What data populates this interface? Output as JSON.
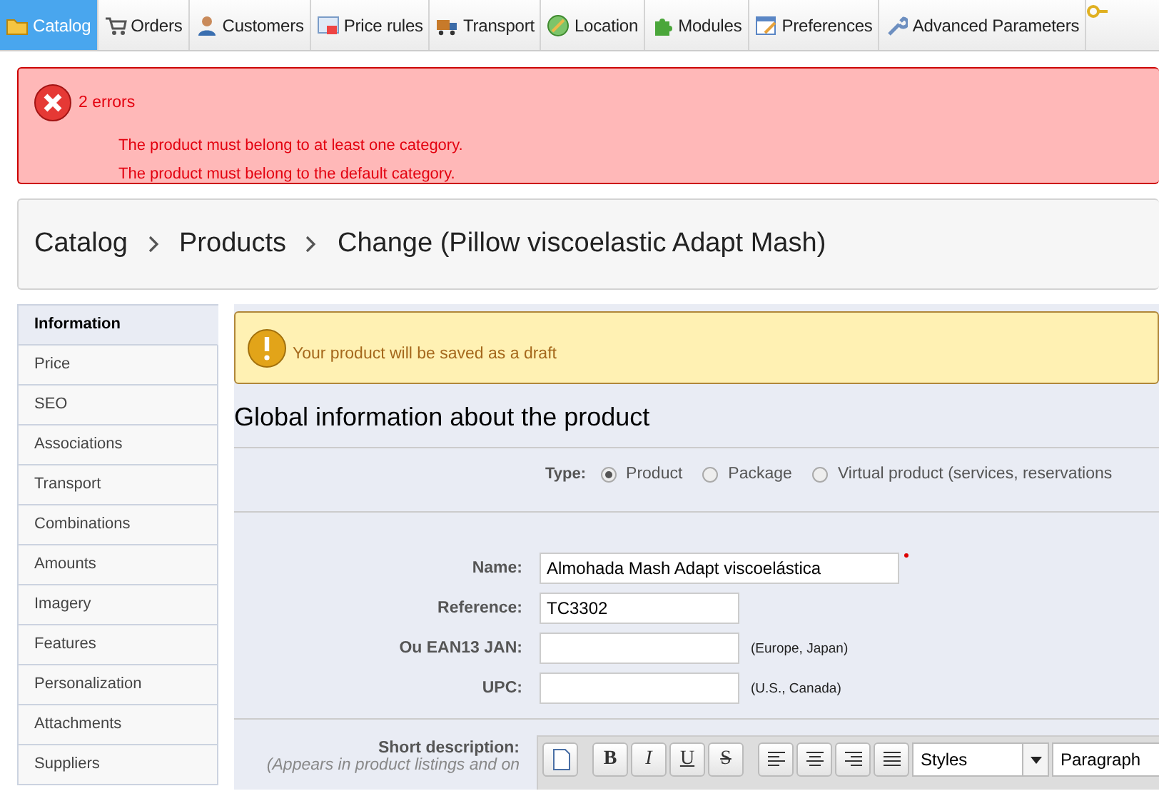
{
  "nav": [
    {
      "label": "Catalog",
      "selected": true
    },
    {
      "label": "Orders",
      "selected": false
    },
    {
      "label": "Customers",
      "selected": false
    },
    {
      "label": "Price rules",
      "selected": false
    },
    {
      "label": "Transport",
      "selected": false
    },
    {
      "label": "Location",
      "selected": false
    },
    {
      "label": "Modules",
      "selected": false
    },
    {
      "label": "Preferences",
      "selected": false
    },
    {
      "label": "Advanced Parameters",
      "selected": false
    }
  ],
  "errors": {
    "title": "2 errors",
    "messages": [
      "The product must belong to at least one category.",
      "The product must belong to the default category."
    ]
  },
  "breadcrumb": [
    "Catalog",
    "Products",
    "Change (Pillow viscoelastic Adapt Mash)"
  ],
  "sidebar": [
    {
      "label": "Information",
      "selected": true
    },
    {
      "label": "Price",
      "selected": false
    },
    {
      "label": "SEO",
      "selected": false
    },
    {
      "label": "Associations",
      "selected": false
    },
    {
      "label": "Transport",
      "selected": false
    },
    {
      "label": "Combinations",
      "selected": false
    },
    {
      "label": "Amounts",
      "selected": false
    },
    {
      "label": "Imagery",
      "selected": false
    },
    {
      "label": "Features",
      "selected": false
    },
    {
      "label": "Personalization",
      "selected": false
    },
    {
      "label": "Attachments",
      "selected": false
    },
    {
      "label": "Suppliers",
      "selected": false
    }
  ],
  "warning": "Your product will be saved as a draft",
  "heading": "Global information about the product",
  "type": {
    "label": "Type:",
    "options": [
      {
        "label": "Product",
        "selected": true
      },
      {
        "label": "Package",
        "selected": false
      },
      {
        "label": "Virtual product (services, reservations",
        "selected": false
      }
    ]
  },
  "fields": [
    {
      "label": "Name:",
      "value": "Almohada Mash Adapt viscoelástica",
      "required": true,
      "wide": true
    },
    {
      "label": "Reference:",
      "value": "TC3302",
      "required": false,
      "wide": false
    },
    {
      "label": "Ou EAN13 JAN:",
      "hint": "(Europe, Japan)",
      "required": false,
      "wide": false
    },
    {
      "label": "UPC:",
      "hint": "(U.S., Canada)",
      "required": false,
      "wide": false
    }
  ],
  "short_description": {
    "label": "Short description:",
    "note": "(Appears in product listings and on",
    "toolbar": {
      "format_buttons": [
        "B",
        "I",
        "U",
        "S"
      ],
      "selects": [
        "Styles",
        "Paragraph"
      ]
    }
  }
}
